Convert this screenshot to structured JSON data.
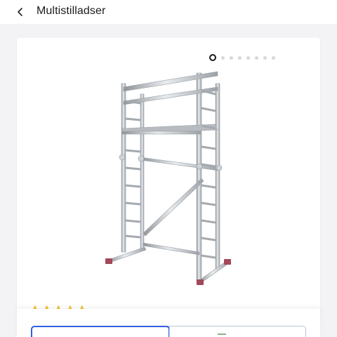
{
  "header": {
    "title": "Multistilladser"
  },
  "gallery": {
    "image_count": 8,
    "active_index": 0,
    "image_alt": "Aluminium multistillads"
  },
  "rating": {
    "value": 5,
    "max": 5
  },
  "colors": {
    "accent": "#2f5fe1",
    "star": "#f2c12e",
    "background": "#f3f3f5"
  },
  "icons": {
    "back": "chevron-left-icon"
  }
}
